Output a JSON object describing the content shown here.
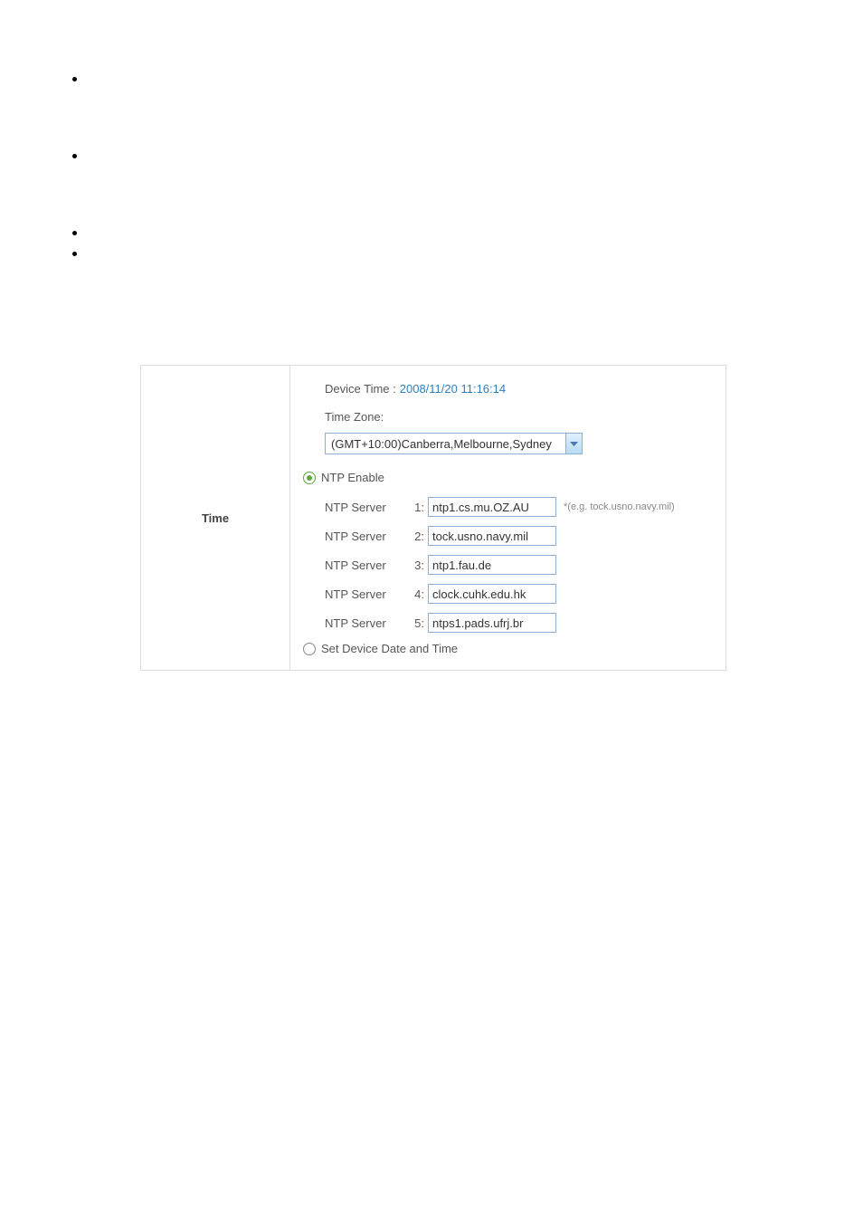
{
  "time": {
    "section_title": "Time",
    "device_time_label": "Device Time :",
    "device_time_value": "2008/11/20 11:16:14",
    "tz_label": "Time Zone:",
    "tz_selected": "(GMT+10:00)Canberra,Melbourne,Sydney",
    "ntp_enable_label": "NTP Enable",
    "server_label": "NTP Server",
    "servers": [
      {
        "num": "1:",
        "value": "ntp1.cs.mu.OZ.AU",
        "hint": "*(e.g. tock.usno.navy.mil)"
      },
      {
        "num": "2:",
        "value": "tock.usno.navy.mil",
        "hint": ""
      },
      {
        "num": "3:",
        "value": "ntp1.fau.de",
        "hint": ""
      },
      {
        "num": "4:",
        "value": "clock.cuhk.edu.hk",
        "hint": ""
      },
      {
        "num": "5:",
        "value": "ntps1.pads.ufrj.br",
        "hint": ""
      }
    ],
    "manual_label": "Set Device Date and Time"
  }
}
